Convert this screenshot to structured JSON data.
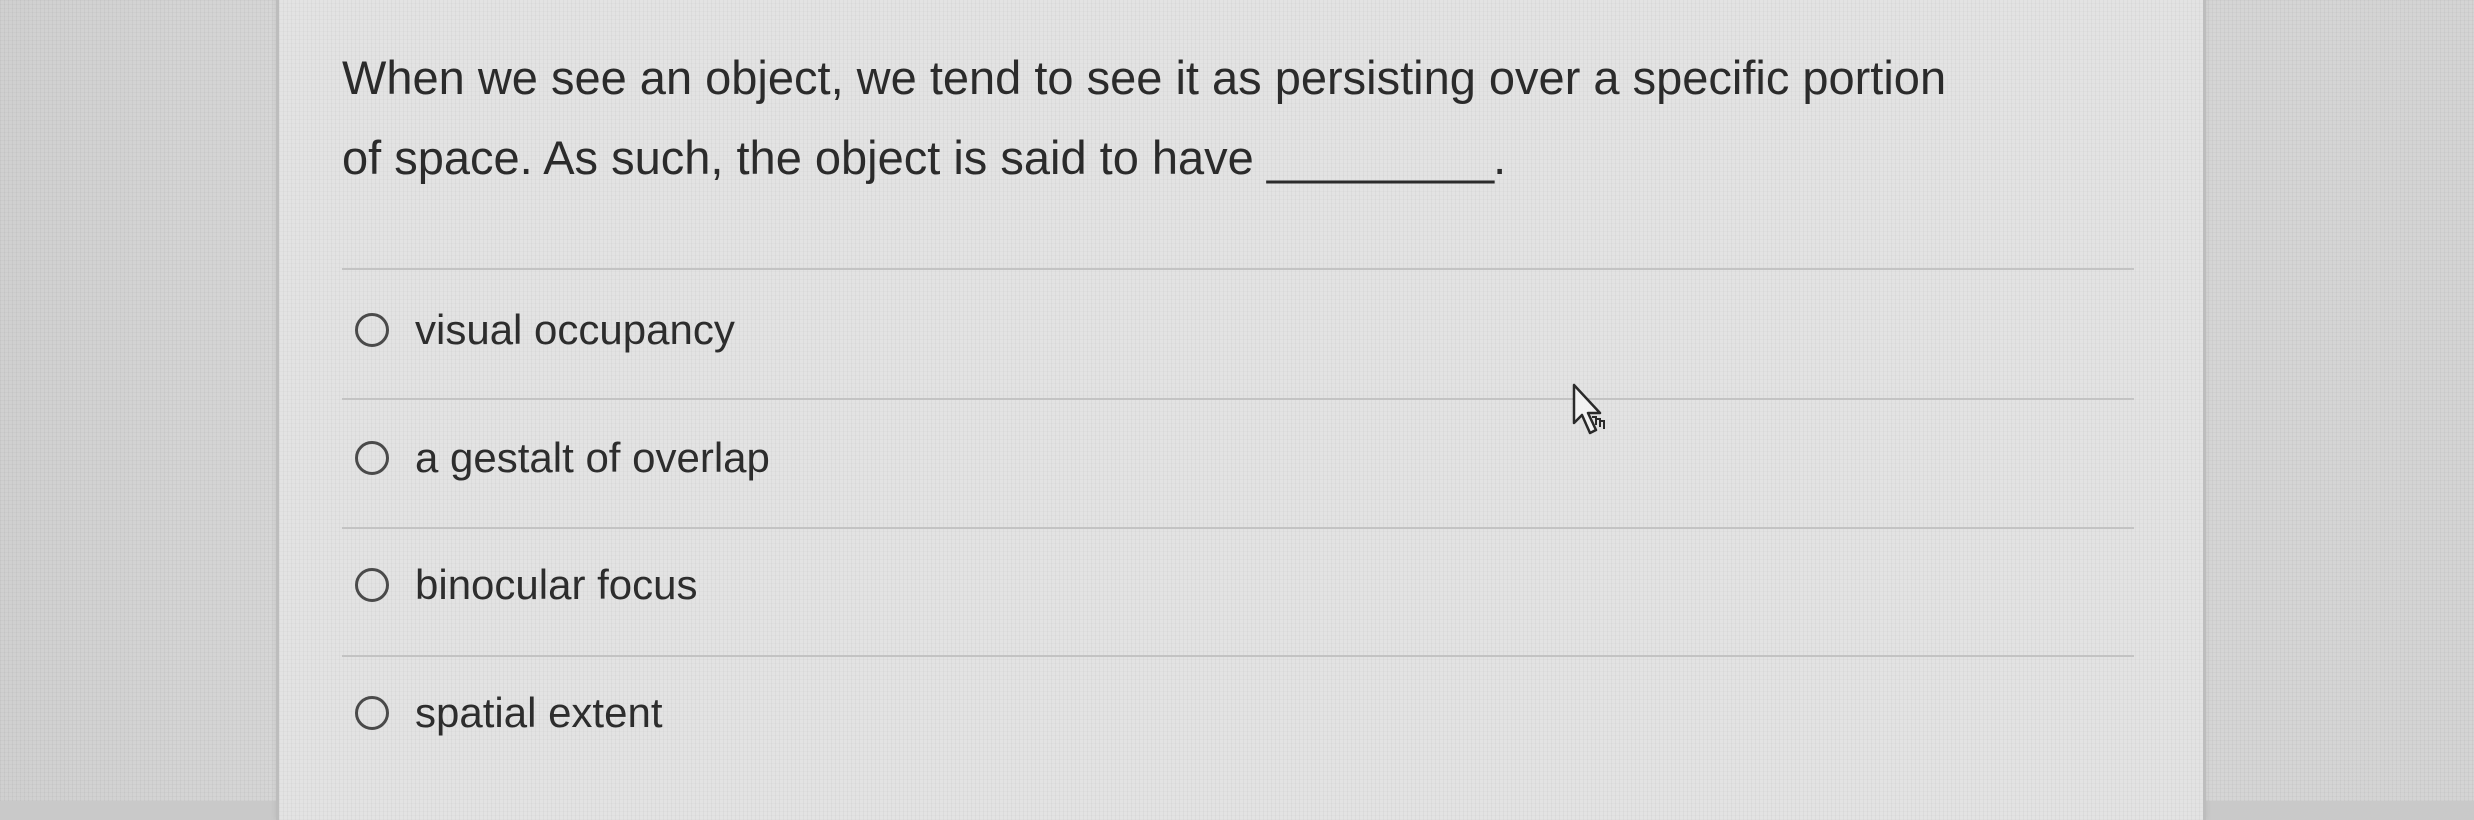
{
  "question": {
    "text_line1": "When we see an object, we tend to see it as persisting over a specific portion",
    "text_line2": "of space. As such, the object is said to have",
    "blank": "_________",
    "period": "."
  },
  "options": [
    {
      "label": "visual occupancy",
      "selected": false
    },
    {
      "label": "a gestalt of overlap",
      "selected": false
    },
    {
      "label": "binocular focus",
      "selected": false
    },
    {
      "label": "spatial extent",
      "selected": false
    }
  ],
  "cursor": {
    "icon": "hand-pointer-icon"
  }
}
